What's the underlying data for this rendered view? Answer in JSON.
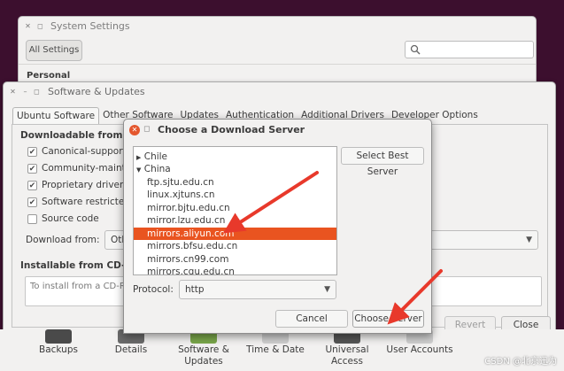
{
  "system_settings": {
    "title": "System Settings",
    "all_settings_label": "All Settings",
    "section_personal": "Personal"
  },
  "software_updates": {
    "title": "Software & Updates",
    "tabs": [
      "Ubuntu Software",
      "Other Software",
      "Updates",
      "Authentication",
      "Additional Drivers",
      "Developer Options"
    ],
    "active_tab": "Ubuntu Software",
    "downloadable_heading": "Downloadable from the",
    "checkboxes": [
      {
        "label": "Canonical-supported",
        "checked": true
      },
      {
        "label": "Community-maintain",
        "checked": true
      },
      {
        "label": "Proprietary drivers f",
        "checked": true
      },
      {
        "label": "Software restricted l",
        "checked": true
      },
      {
        "label": "Source code",
        "checked": false
      }
    ],
    "download_from_label": "Download from:",
    "download_from_value": "Othe",
    "cdrom_heading": "Installable from CD-ROM",
    "cdrom_text": "To install from a CD-RO",
    "revert_label": "Revert",
    "close_label": "Close"
  },
  "launcher": [
    {
      "label": "Backups",
      "icon": "backups-icon"
    },
    {
      "label": "Details",
      "icon": "details-icon"
    },
    {
      "label": "Software & Updates",
      "icon": "software-updates-icon"
    },
    {
      "label": "Time & Date",
      "icon": "time-date-icon"
    },
    {
      "label": "Universal Access",
      "icon": "universal-access-icon"
    },
    {
      "label": "User Accounts",
      "icon": "user-accounts-icon"
    }
  ],
  "dialog": {
    "title": "Choose a Download Server",
    "servers": [
      {
        "label": "Chile",
        "type": "collapsed-group"
      },
      {
        "label": "China",
        "type": "expanded-group"
      },
      {
        "label": "ftp.sjtu.edu.cn",
        "type": "item"
      },
      {
        "label": "linux.xjtuns.cn",
        "type": "item"
      },
      {
        "label": "mirror.bjtu.edu.cn",
        "type": "item"
      },
      {
        "label": "mirror.lzu.edu.cn",
        "type": "item"
      },
      {
        "label": "mirrors.aliyun.com",
        "type": "item",
        "selected": true
      },
      {
        "label": "mirrors.bfsu.edu.cn",
        "type": "item"
      },
      {
        "label": "mirrors.cn99.com",
        "type": "item"
      },
      {
        "label": "mirrors.cqu.edu.cn",
        "type": "item"
      }
    ],
    "select_best_label": "Select Best Server",
    "protocol_label": "Protocol:",
    "protocol_value": "http",
    "cancel_label": "Cancel",
    "choose_label": "Choose Server"
  },
  "watermark": "CSDN @北京迅为",
  "colors": {
    "selection": "#e95420",
    "annotation_arrow": "#e8392b",
    "desktop_bg": "#3c0f2e"
  }
}
